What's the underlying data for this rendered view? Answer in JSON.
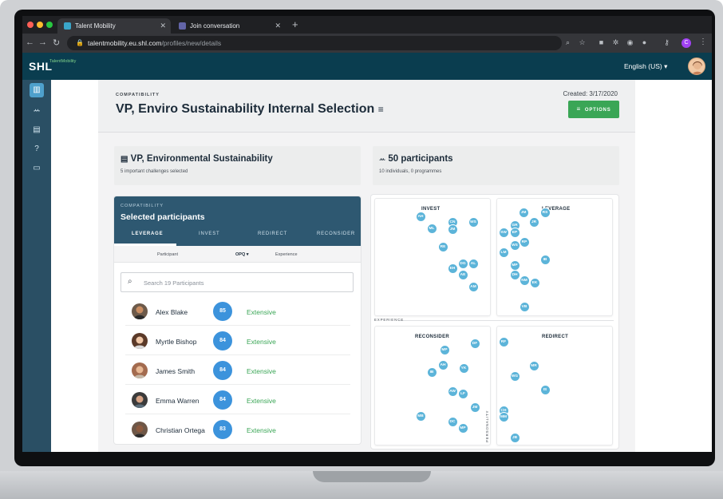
{
  "browser": {
    "tabs": [
      {
        "title": "Talent Mobility",
        "active": true
      },
      {
        "title": "Join conversation",
        "active": false
      }
    ],
    "url_host": "talentmobility.eu.shl.com",
    "url_path": "/profiles/new/details",
    "profile_initial": "C"
  },
  "app": {
    "logo": "SHL",
    "logo_sub": "TalentMobility",
    "language": "English (US)"
  },
  "page": {
    "eyebrow": "COMPATIBILITY",
    "title": "VP, Enviro Sustainability Internal Selection",
    "created": "Created: 3/17/2020",
    "options_label": "OPTIONS"
  },
  "role_card": {
    "title": "VP, Environmental Sustainability",
    "subtitle": "5 important challenges selected"
  },
  "participants_card": {
    "title": "50 participants",
    "subtitle": "10 individuals, 0 programmes"
  },
  "panel": {
    "eyebrow": "COMPATIBILITY",
    "title": "Selected participants",
    "tabs": [
      "LEVERAGE",
      "INVEST",
      "REDIRECT",
      "RECONSIDER"
    ],
    "columns": [
      "Participant",
      "OPQ ▾",
      "Experience"
    ],
    "search_placeholder": "Search 19 Participants",
    "rows": [
      {
        "name": "Alex Blake",
        "score": "85",
        "experience": "Extensive"
      },
      {
        "name": "Myrtle Bishop",
        "score": "84",
        "experience": "Extensive"
      },
      {
        "name": "James Smith",
        "score": "84",
        "experience": "Extensive"
      },
      {
        "name": "Emma Warren",
        "score": "84",
        "experience": "Extensive"
      },
      {
        "name": "Christian Ortega",
        "score": "83",
        "experience": "Extensive"
      }
    ]
  },
  "chart_data": {
    "type": "scatter",
    "quadrants": [
      "INVEST",
      "LEVERAGE",
      "RECONSIDER",
      "REDIRECT"
    ],
    "xlabel": "EXPERIENCE",
    "ylabel": "PERSONALITY",
    "points": [
      {
        "label": "AH",
        "q": "INVEST"
      },
      {
        "label": "ML",
        "q": "INVEST"
      },
      {
        "label": "CN",
        "q": "INVEST"
      },
      {
        "label": "JM",
        "q": "INVEST"
      },
      {
        "label": "WS",
        "q": "INVEST"
      },
      {
        "label": "RE",
        "q": "INVEST"
      },
      {
        "label": "EH",
        "q": "INVEST"
      },
      {
        "label": "DG",
        "q": "INVEST"
      },
      {
        "label": "AL",
        "q": "INVEST"
      },
      {
        "label": "AE",
        "q": "INVEST"
      },
      {
        "label": "AM",
        "q": "INVEST"
      },
      {
        "label": "JM",
        "q": "LEVERAGE"
      },
      {
        "label": "RS",
        "q": "LEVERAGE"
      },
      {
        "label": "JR",
        "q": "LEVERAGE"
      },
      {
        "label": "GR",
        "q": "LEVERAGE"
      },
      {
        "label": "SW",
        "q": "LEVERAGE"
      },
      {
        "label": "EP",
        "q": "LEVERAGE"
      },
      {
        "label": "WS",
        "q": "LEVERAGE"
      },
      {
        "label": "RP",
        "q": "LEVERAGE"
      },
      {
        "label": "LM",
        "q": "LEVERAGE"
      },
      {
        "label": "IB",
        "q": "LEVERAGE"
      },
      {
        "label": "MP",
        "q": "LEVERAGE"
      },
      {
        "label": "DH",
        "q": "LEVERAGE"
      },
      {
        "label": "NM",
        "q": "LEVERAGE"
      },
      {
        "label": "EK",
        "q": "LEVERAGE"
      },
      {
        "label": "VB",
        "q": "LEVERAGE"
      },
      {
        "label": "DF",
        "q": "RECONSIDER"
      },
      {
        "label": "MP",
        "q": "RECONSIDER"
      },
      {
        "label": "AH",
        "q": "RECONSIDER"
      },
      {
        "label": "IB",
        "q": "RECONSIDER"
      },
      {
        "label": "YK",
        "q": "RECONSIDER"
      },
      {
        "label": "AW",
        "q": "RECONSIDER"
      },
      {
        "label": "LF",
        "q": "RECONSIDER"
      },
      {
        "label": "JM",
        "q": "RECONSIDER"
      },
      {
        "label": "MB",
        "q": "RECONSIDER"
      },
      {
        "label": "DC",
        "q": "RECONSIDER"
      },
      {
        "label": "MP",
        "q": "RECONSIDER"
      },
      {
        "label": "RF",
        "q": "REDIRECT"
      },
      {
        "label": "MR",
        "q": "REDIRECT"
      },
      {
        "label": "WG",
        "q": "REDIRECT"
      },
      {
        "label": "IS",
        "q": "REDIRECT"
      },
      {
        "label": "CH",
        "q": "REDIRECT"
      },
      {
        "label": "MM",
        "q": "REDIRECT"
      },
      {
        "label": "JB",
        "q": "REDIRECT"
      }
    ]
  },
  "colors": {
    "app_header": "#0a3d4f",
    "sidebar": "#2a4f64",
    "panel_header": "#2e5871",
    "accent_green": "#3aa656",
    "score_blue": "#3c93dc",
    "bubble": "#5cb4d9"
  }
}
